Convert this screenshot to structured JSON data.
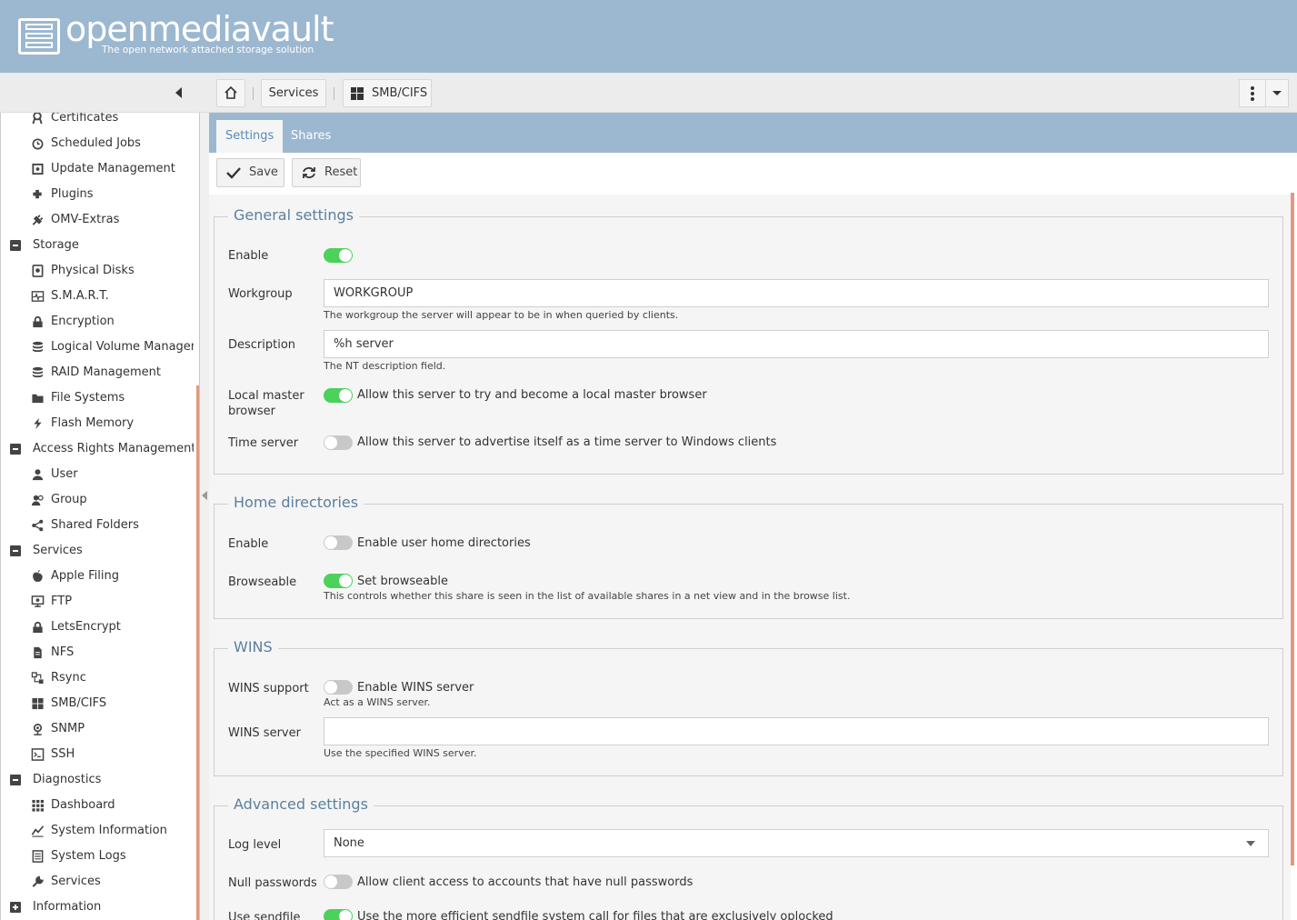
{
  "header": {
    "brand": "openmediavault",
    "tagline": "The open network attached storage solution"
  },
  "breadcrumb": {
    "services": "Services",
    "current": "SMB/CIFS"
  },
  "sidebar": {
    "items": [
      {
        "label": "Certificates",
        "icon": "certificate-icon"
      },
      {
        "label": "Scheduled Jobs",
        "icon": "alarm-clock-icon"
      },
      {
        "label": "Update Management",
        "icon": "update-icon"
      },
      {
        "label": "Plugins",
        "icon": "puzzle-icon"
      },
      {
        "label": "OMV-Extras",
        "icon": "plug-icon"
      },
      {
        "label": "Storage",
        "icon": "collapse-icon"
      },
      {
        "label": "Physical Disks",
        "icon": "disk-icon"
      },
      {
        "label": "S.M.A.R.T.",
        "icon": "pulse-icon"
      },
      {
        "label": "Encryption",
        "icon": "lock-icon"
      },
      {
        "label": "Logical Volume Managem",
        "icon": "database-icon"
      },
      {
        "label": "RAID Management",
        "icon": "database-icon"
      },
      {
        "label": "File Systems",
        "icon": "folder-icon"
      },
      {
        "label": "Flash Memory",
        "icon": "flash-icon"
      },
      {
        "label": "Access Rights Management",
        "icon": "collapse-icon"
      },
      {
        "label": "User",
        "icon": "user-icon"
      },
      {
        "label": "Group",
        "icon": "group-icon"
      },
      {
        "label": "Shared Folders",
        "icon": "share-icon"
      },
      {
        "label": "Services",
        "icon": "collapse-icon"
      },
      {
        "label": "Apple Filing",
        "icon": "apple-icon"
      },
      {
        "label": "FTP",
        "icon": "ftp-icon"
      },
      {
        "label": "LetsEncrypt",
        "icon": "lock-icon"
      },
      {
        "label": "NFS",
        "icon": "file-icon"
      },
      {
        "label": "Rsync",
        "icon": "rsync-icon"
      },
      {
        "label": "SMB/CIFS",
        "icon": "windows-icon"
      },
      {
        "label": "SNMP",
        "icon": "snmp-icon"
      },
      {
        "label": "SSH",
        "icon": "terminal-icon"
      },
      {
        "label": "Diagnostics",
        "icon": "collapse-icon"
      },
      {
        "label": "Dashboard",
        "icon": "grid-icon"
      },
      {
        "label": "System Information",
        "icon": "chart-line-icon"
      },
      {
        "label": "System Logs",
        "icon": "list-icon"
      },
      {
        "label": "Services",
        "icon": "wrench-icon"
      },
      {
        "label": "Information",
        "icon": "expand-icon"
      }
    ]
  },
  "tabs": {
    "settings": "Settings",
    "shares": "Shares"
  },
  "actions": {
    "save": "Save",
    "reset": "Reset"
  },
  "general": {
    "title": "General settings",
    "enable_label": "Enable",
    "enable_on": true,
    "workgroup_label": "Workgroup",
    "workgroup_value": "WORKGROUP",
    "workgroup_hint": "The workgroup the server will appear to be in when queried by clients.",
    "description_label": "Description",
    "description_value": "%h server",
    "description_hint": "The NT description field.",
    "local_master_label": "Local master browser",
    "local_master_text": "Allow this server to try and become a local master browser",
    "local_master_on": true,
    "time_server_label": "Time server",
    "time_server_text": "Allow this server to advertise itself as a time server to Windows clients",
    "time_server_on": false
  },
  "home": {
    "title": "Home directories",
    "enable_label": "Enable",
    "enable_text": "Enable user home directories",
    "enable_on": false,
    "browseable_label": "Browseable",
    "browseable_text": "Set browseable",
    "browseable_on": true,
    "browseable_hint": "This controls whether this share is seen in the list of available shares in a net view and in the browse list."
  },
  "wins": {
    "title": "WINS",
    "support_label": "WINS support",
    "support_text": "Enable WINS server",
    "support_on": false,
    "support_hint": "Act as a WINS server.",
    "server_label": "WINS server",
    "server_value": "",
    "server_hint": "Use the specified WINS server."
  },
  "advanced": {
    "title": "Advanced settings",
    "log_level_label": "Log level",
    "log_level_value": "None",
    "null_passwords_label": "Null passwords",
    "null_passwords_text": "Allow client access to accounts that have null passwords",
    "null_passwords_on": false,
    "sendfile_label": "Use sendfile",
    "sendfile_text": "Use the more efficient sendfile system call for files that are exclusively oplocked",
    "sendfile_on": true
  },
  "colors": {
    "header_bg": "#9bb8d0",
    "toggle_on": "#4cd15b",
    "toggle_off": "#c8c8c8",
    "section_title": "#5a7fa0",
    "scroll_accent": "#e09a82"
  }
}
